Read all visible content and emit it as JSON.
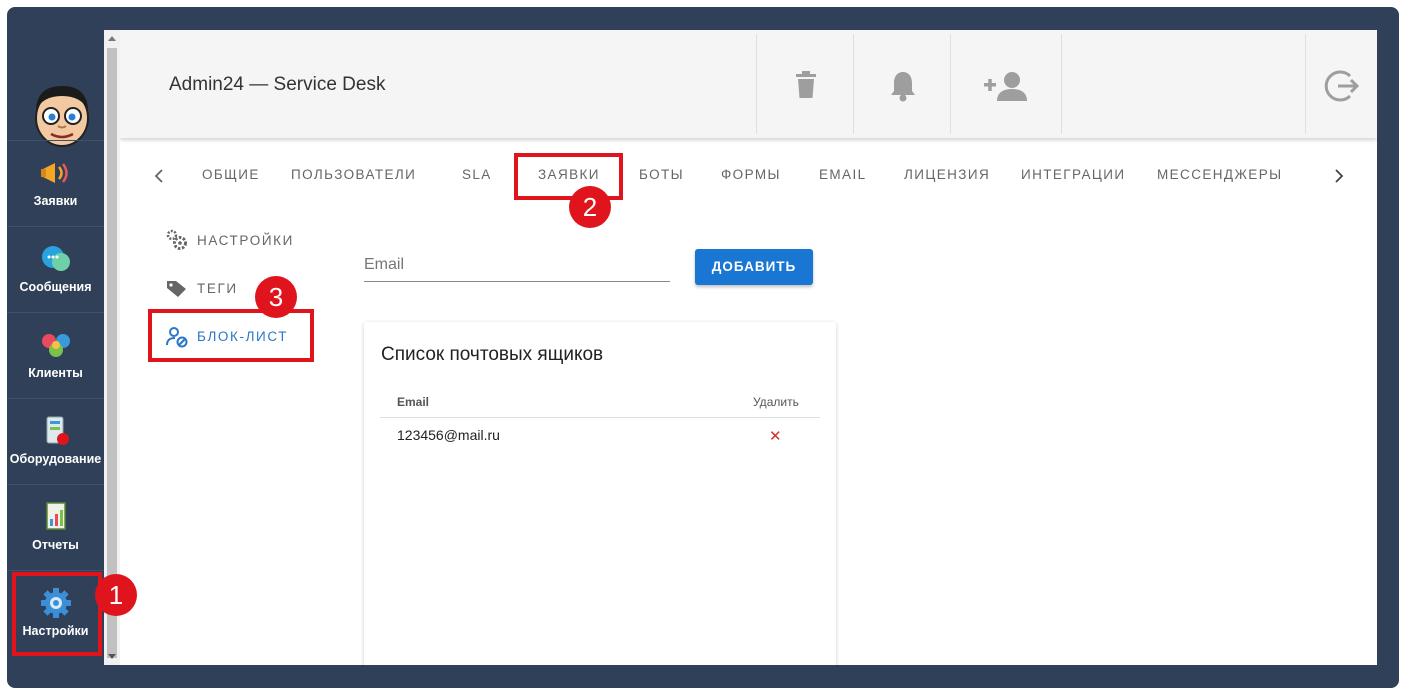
{
  "app": {
    "title": "Admin24 — Service Desk"
  },
  "sidebar": {
    "items": [
      {
        "label": "Заявки",
        "icon": "megaphone-icon"
      },
      {
        "label": "Сообщения",
        "icon": "chat-bubbles-icon"
      },
      {
        "label": "Клиенты",
        "icon": "clients-icon"
      },
      {
        "label": "Оборудование",
        "icon": "equipment-icon"
      },
      {
        "label": "Отчеты",
        "icon": "reports-icon"
      },
      {
        "label": "Настройки",
        "icon": "gear-icon"
      }
    ]
  },
  "toolbar": {
    "buttons": [
      {
        "icon": "trash-icon"
      },
      {
        "icon": "bell-icon"
      },
      {
        "icon": "add-user-icon"
      },
      {
        "icon": "logout-icon"
      }
    ]
  },
  "tabs": [
    "ОБЩИЕ",
    "ПОЛЬЗОВАТЕЛИ",
    "SLA",
    "ЗАЯВКИ",
    "БОТЫ",
    "ФОРМЫ",
    "EMAIL",
    "ЛИЦЕНЗИЯ",
    "ИНТЕГРАЦИИ",
    "МЕССЕНДЖЕРЫ"
  ],
  "active_tab": "ЗАЯВКИ",
  "subnav": {
    "items": [
      "НАСТРОЙКИ",
      "ТЕГИ",
      "БЛОК-ЛИСТ"
    ],
    "active": "БЛОК-ЛИСТ"
  },
  "form": {
    "email_placeholder": "Email",
    "add_label": "ДОБАВИТЬ"
  },
  "mailbox_list": {
    "title": "Список почтовых ящиков",
    "columns": [
      "Email",
      "Удалить"
    ],
    "rows": [
      {
        "email": "123456@mail.ru"
      }
    ],
    "delete_symbol": "✕"
  },
  "annotations": [
    "1",
    "2",
    "3"
  ],
  "colors": {
    "sidebar_bg": "#2f4058",
    "accent": "#1976d2",
    "highlight": "#e0141c"
  }
}
